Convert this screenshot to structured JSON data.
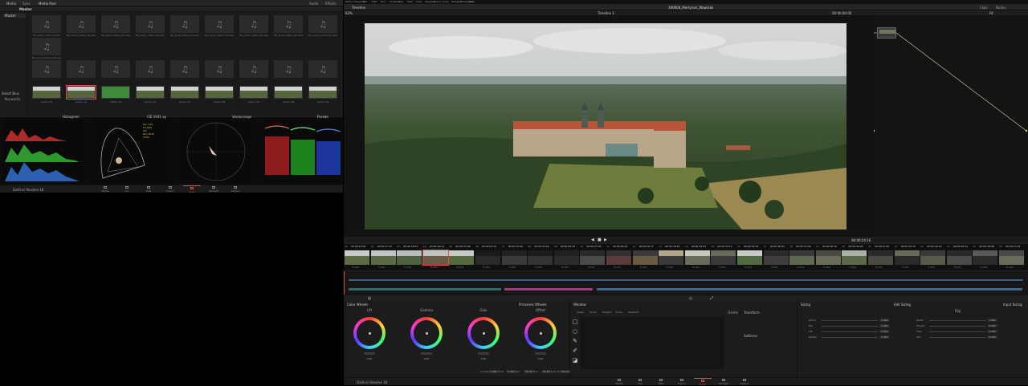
{
  "left": {
    "tabs": [
      "Media",
      "Sync",
      "Media Pool"
    ],
    "right_tabs": [
      "Audio",
      "Effects"
    ],
    "bin_header": "Master",
    "side_items": [
      "Master"
    ],
    "smart_bins_label": "Smart Bins",
    "smart_bins_item": "Keywords",
    "audio_clip_names": [
      "HS_Audio_Other_0.wav",
      "HS_Audio_Other_00.wav",
      "HS_Audio_Other_01.wav",
      "HS_Audio_Other_02.wav",
      "HS_Audio_Other_03.wav",
      "HS_Audio_Other_04.wav",
      "HS_Audio_Other_05.wav",
      "HS_Audio_Other_06.wav",
      "HS_Audio_Other_07.wav",
      "HS_Audio_Other_08.wav"
    ],
    "video_clip_names": [
      "Ujecie_01",
      "Ujecie_02",
      "Ujecie_03",
      "Ujecie_04",
      "Ujecie_05",
      "Ujecie_06",
      "Ujecie_07",
      "Ujecie_08",
      "Ujecie_09"
    ],
    "scopes": {
      "histogram": "Histogram",
      "cie": "CIE 1931 xy",
      "vectorscope": "Vectorscope",
      "parade": "Parade"
    },
    "cie_legend": [
      "Rec.709",
      "P3-D65",
      "DCI",
      "Rec.2020",
      "ACES"
    ],
    "app_label": "DaVinci Resolve 18",
    "page_tabs": [
      "Media",
      "Cut",
      "Edit",
      "Fusion",
      "Color",
      "Fairlight",
      "Deliver"
    ],
    "active_page": "Color"
  },
  "right": {
    "topbar_left": "DaVinci Resolve",
    "topbar_menu": [
      "File",
      "Edit",
      "Trim",
      "Timeline",
      "Clip",
      "Mark",
      "View",
      "Playback",
      "Fusion",
      "Color",
      "Fairlight",
      "Workspace",
      "Help"
    ],
    "project_title": "190608_Martyrion_Wawrzak",
    "timeline_label": "Timeline",
    "viewer_timeline_name": "Timeline 1",
    "viewer_timecode": "00:00:24:16",
    "viewer_timecode_small": "00:00:00:00",
    "clips_button": "Clips",
    "nodes_button": "Nodes",
    "fit_label": "Fit",
    "fit_value": "63%",
    "clip_timecodes": [
      "00:00:12:06",
      "00:00:17:12",
      "00:00:18:07",
      "00:00:19:21",
      "00:00:21:06",
      "00:00:22:13",
      "00:00:23:20",
      "00:00:24:16",
      "00:00:25:23",
      "00:00:27:03",
      "00:00:28:10",
      "00:00:29:17",
      "00:00:30:24",
      "00:00:32:05",
      "00:00:33:12",
      "00:00:34:19",
      "00:00:36:02",
      "00:00:37:09",
      "00:00:38:16",
      "00:00:39:23",
      "00:00:41:05",
      "00:00:42:12",
      "00:00:43:19",
      "00:00:45:01",
      "00:00:46:08",
      "00:00:47:15"
    ],
    "clip_numbers": [
      "01",
      "02",
      "03",
      "04",
      "05",
      "06",
      "07",
      "08",
      "09",
      "10",
      "11",
      "12",
      "13",
      "14",
      "15",
      "16",
      "17",
      "18",
      "19",
      "20",
      "21",
      "22",
      "23",
      "24",
      "25",
      "26"
    ],
    "clip_codec": "H.264",
    "color_wheels": {
      "title": "Color Wheels",
      "mode": "Primaries Wheels",
      "wheels": [
        "Lift",
        "Gamma",
        "Gain",
        "Offset"
      ],
      "wheel_values": [
        "0.00",
        "0.00",
        "0.00",
        "0.00"
      ],
      "bottom_labels": [
        "Contrast",
        "Pivot",
        "Sat",
        "Hue",
        "Lum Mix"
      ],
      "bottom_values": [
        "1.000",
        "0.435",
        "50.00",
        "50.00",
        "100.00"
      ]
    },
    "window_panel": {
      "title": "Window",
      "tools": [
        "Linear",
        "Circle",
        "Polygon",
        "Curve",
        "Gradient"
      ],
      "delete_label": "Delete",
      "transform_label": "Transform",
      "softness_label": "Softness"
    },
    "sizing_panel": {
      "title": "Sizing",
      "mode": "Edit Sizing",
      "subtitle": "Input Sizing",
      "rows_left": [
        "Zoom",
        "Pan",
        "Tilt",
        "Rotate"
      ],
      "rows_right": [
        "Width",
        "Height",
        "Pitch",
        "Yaw"
      ],
      "values": [
        "1.000",
        "0.000",
        "0.000",
        "0.000"
      ],
      "flip_label": "Flip"
    },
    "app_label": "DaVinci Resolve 18",
    "page_tabs": [
      "Media",
      "Cut",
      "Edit",
      "Fusion",
      "Color",
      "Fairlight",
      "Deliver"
    ],
    "active_page": "Color"
  },
  "colors": {
    "accent": "#e64b3c",
    "panel": "#1e1e1f",
    "bar": "#262628"
  }
}
